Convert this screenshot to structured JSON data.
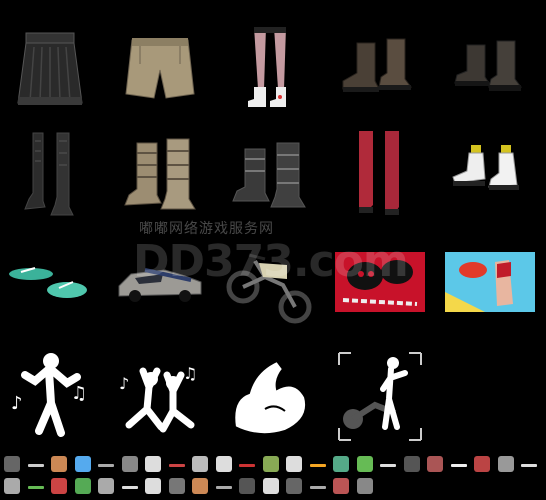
{
  "inventory": {
    "rows": [
      [
        {
          "name": "leather-skirt",
          "icon": "skirt-icon"
        },
        {
          "name": "khaki-shorts",
          "icon": "shorts-icon"
        },
        {
          "name": "pink-stockings-white-boots",
          "icon": "legs-icon"
        },
        {
          "name": "brown-ankle-boots",
          "icon": "boots-icon"
        },
        {
          "name": "dark-ankle-boots",
          "icon": "boots-icon"
        }
      ],
      [
        {
          "name": "black-knee-boots",
          "icon": "boots-icon"
        },
        {
          "name": "tan-strapped-boots",
          "icon": "boots-icon"
        },
        {
          "name": "black-buckle-boots",
          "icon": "boots-icon"
        },
        {
          "name": "red-thigh-boots",
          "icon": "legs-icon"
        },
        {
          "name": "white-sneakers",
          "icon": "sneakers-icon"
        }
      ],
      [
        {
          "name": "teal-sandals",
          "icon": "sandals-icon"
        },
        {
          "name": "muscle-car",
          "icon": "car-icon"
        },
        {
          "name": "dirt-bike",
          "icon": "motorbike-icon"
        },
        {
          "name": "skull-chain-spray",
          "icon": "spray-icon"
        },
        {
          "name": "pop-art-spray",
          "icon": "spray-icon"
        }
      ],
      [
        {
          "name": "dance-emote",
          "icon": "dance-emote-icon"
        },
        {
          "name": "jump-emote",
          "icon": "jump-emote-icon"
        },
        {
          "name": "flex-emote",
          "icon": "muscle-icon"
        },
        {
          "name": "bike-pose-emote",
          "icon": "bike-pose-icon"
        }
      ]
    ]
  },
  "watermark": {
    "cn": "嘟嘟网络游戏服务网",
    "en": "DD373.com"
  },
  "badges": {
    "row1": [
      "#666",
      "#ccc",
      "#c85",
      "#5ae",
      "#aaa",
      "#888",
      "#ddd",
      "#c44",
      "#bbb",
      "#ddd",
      "#c33",
      "#8a5",
      "#ddd",
      "#f5a623",
      "#5a8",
      "#6b5",
      "#ddd",
      "#555",
      "#a55",
      "#eee",
      "#b44",
      "#999",
      "#ddd"
    ],
    "row2": [
      "#aaa",
      "#6b5",
      "#c44",
      "#5a5",
      "#aaa",
      "#ddd",
      "#ddd",
      "#777",
      "#c85",
      "#aaa",
      "#555",
      "#ddd",
      "#666",
      "#aaa",
      "#b55",
      "#888"
    ]
  },
  "colors": {
    "background": "#000000",
    "accent_badge": "#f5a623"
  }
}
